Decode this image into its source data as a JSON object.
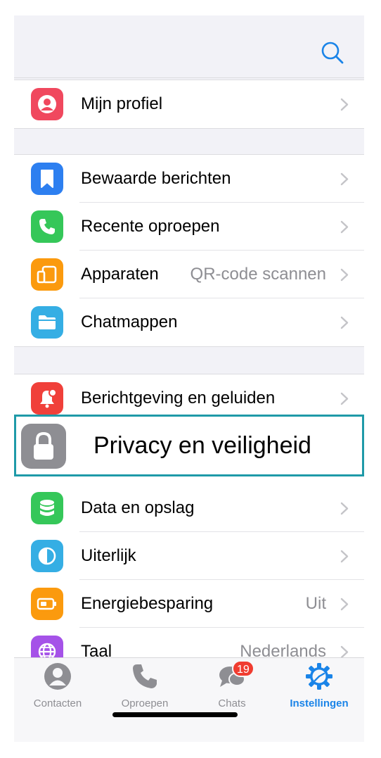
{
  "header": {
    "search_icon": "search-icon"
  },
  "groups": [
    {
      "items": [
        {
          "label": "Mijn profiel",
          "icon": "profile-icon",
          "color": "#f0485e"
        }
      ]
    },
    {
      "items": [
        {
          "label": "Bewaarde berichten",
          "icon": "bookmark-icon",
          "color": "#2d7ff0"
        },
        {
          "label": "Recente oproepen",
          "icon": "phone-icon",
          "color": "#35c759"
        },
        {
          "label": "Apparaten",
          "value": "QR-code scannen",
          "icon": "devices-icon",
          "color": "#fb9a0e"
        },
        {
          "label": "Chatmappen",
          "icon": "folder-icon",
          "color": "#35aee4"
        }
      ]
    },
    {
      "items": [
        {
          "label": "Berichtgeving en geluiden",
          "icon": "bell-icon",
          "color": "#f0403a"
        },
        {
          "label": "Privacy en veiligheid",
          "icon": "lock-icon",
          "color": "#8e8e93",
          "highlighted": true
        },
        {
          "label": "Data en opslag",
          "icon": "database-icon",
          "color": "#35c759"
        },
        {
          "label": "Uiterlijk",
          "icon": "appearance-icon",
          "color": "#35aee4"
        },
        {
          "label": "Energiebesparing",
          "value": "Uit",
          "icon": "battery-icon",
          "color": "#fb9a0e"
        },
        {
          "label": "Taal",
          "value": "Nederlands",
          "icon": "globe-icon",
          "color": "#a552e8"
        }
      ]
    }
  ],
  "tabs": [
    {
      "label": "Contacten",
      "icon": "contacts-icon"
    },
    {
      "label": "Oproepen",
      "icon": "calls-icon"
    },
    {
      "label": "Chats",
      "icon": "chats-icon",
      "badge": "19"
    },
    {
      "label": "Instellingen",
      "icon": "settings-icon",
      "active": true
    }
  ],
  "colors": {
    "accent": "#1a84e8",
    "highlight_border": "#1f9aa8",
    "badge": "#f03c30"
  }
}
